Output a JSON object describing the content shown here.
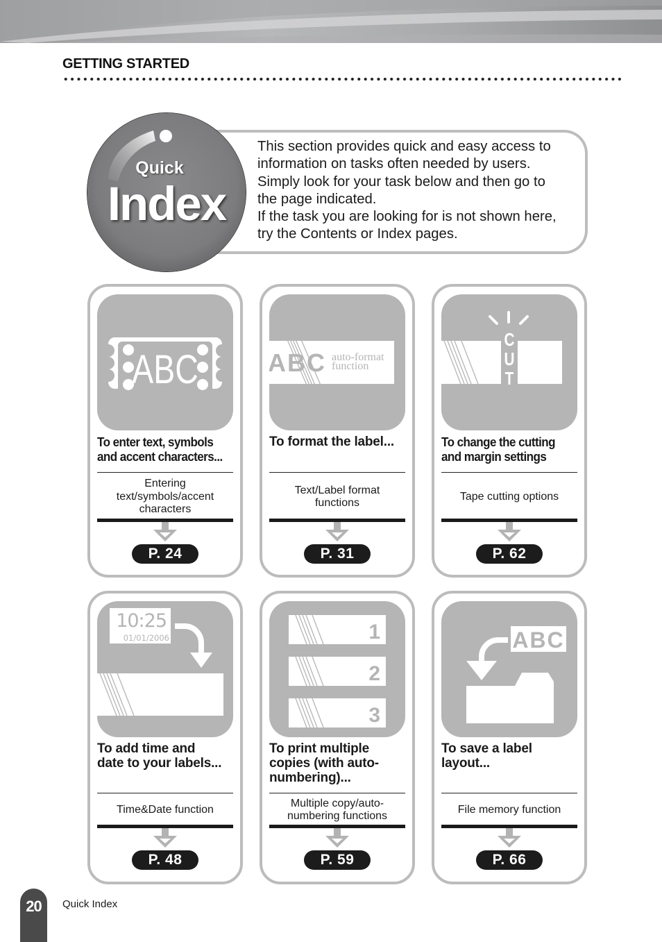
{
  "header": {
    "section_title": "GETTING STARTED"
  },
  "badge": {
    "line1": "Quick",
    "line2": "Index"
  },
  "intro": {
    "lines": [
      "This section provides quick and easy access to",
      "information on tasks often needed by users.",
      "Simply look for your task below and then go to",
      "the page indicated.",
      "If the task you are looking for is not shown here,",
      "try the Contents or Index pages."
    ]
  },
  "cards": [
    {
      "icon": "abc-tape-icon",
      "heading_lines": [
        "To enter text, symbols",
        "and accent characters..."
      ],
      "sub_lines": [
        "Entering",
        "text/symbols/accent",
        "characters"
      ],
      "page": "P. 24",
      "illus_text": "ABC"
    },
    {
      "icon": "auto-format-icon",
      "heading_lines": [
        "To format the label..."
      ],
      "sub_lines": [
        "Text/Label format",
        "functions"
      ],
      "page": "P. 31",
      "illus_text": "ABC",
      "illus_caption": [
        "auto-format",
        "function"
      ]
    },
    {
      "icon": "cut-icon",
      "heading_lines": [
        "To change the cutting",
        "and margin settings"
      ],
      "sub_lines": [
        "Tape cutting options"
      ],
      "page": "P. 62",
      "illus_text": [
        "C",
        "U",
        "T"
      ]
    },
    {
      "icon": "clock-date-icon",
      "heading_lines": [
        "To add time and",
        "date to your labels..."
      ],
      "sub_lines": [
        "Time&Date function"
      ],
      "page": "P. 48",
      "illus_time": "10:25",
      "illus_date": "01/01/2006"
    },
    {
      "icon": "numbered-copies-icon",
      "heading_lines": [
        "To print multiple",
        "copies (with auto-",
        "numbering)..."
      ],
      "sub_lines": [
        "Multiple copy/auto-",
        "numbering functions"
      ],
      "page": "P. 59",
      "illus_numbers": [
        "1",
        "2",
        "3"
      ]
    },
    {
      "icon": "save-folder-icon",
      "heading_lines": [
        "To save a label",
        "layout..."
      ],
      "sub_lines": [
        "File memory function"
      ],
      "page": "P. 66",
      "illus_text": "ABC"
    }
  ],
  "footer": {
    "page_number": "20",
    "label": "Quick Index"
  },
  "colors": {
    "panel_gray": "#b5b5b6",
    "border_gray": "#bcbcbc",
    "pill_black": "#1c1c1c",
    "badge_gray": "#7c7c7e"
  }
}
